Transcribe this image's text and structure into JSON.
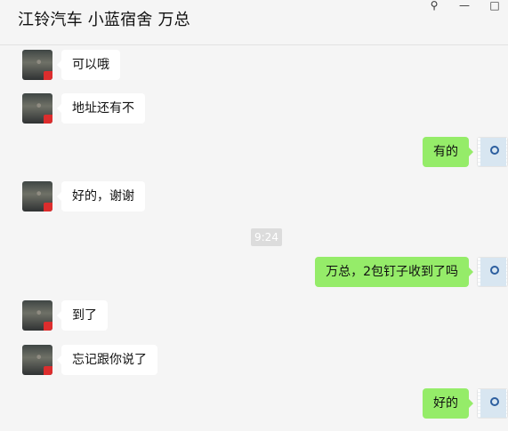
{
  "window": {
    "title": "江铃汽车 小蓝宿舍 万总",
    "controls": {
      "pin": "⚲",
      "minimize": "—",
      "maximize": "□"
    }
  },
  "messages": [
    {
      "side": "left",
      "text": "可以哦"
    },
    {
      "side": "left",
      "text": "地址还有不"
    },
    {
      "side": "right",
      "text": "有的"
    },
    {
      "side": "left",
      "text": "好的，谢谢"
    },
    {
      "side": "time",
      "text": "9:24"
    },
    {
      "side": "right",
      "text": "万总，2包钉子收到了吗"
    },
    {
      "side": "left",
      "text": "到了"
    },
    {
      "side": "left",
      "text": "忘记跟你说了"
    },
    {
      "side": "right",
      "text": "好的"
    }
  ]
}
